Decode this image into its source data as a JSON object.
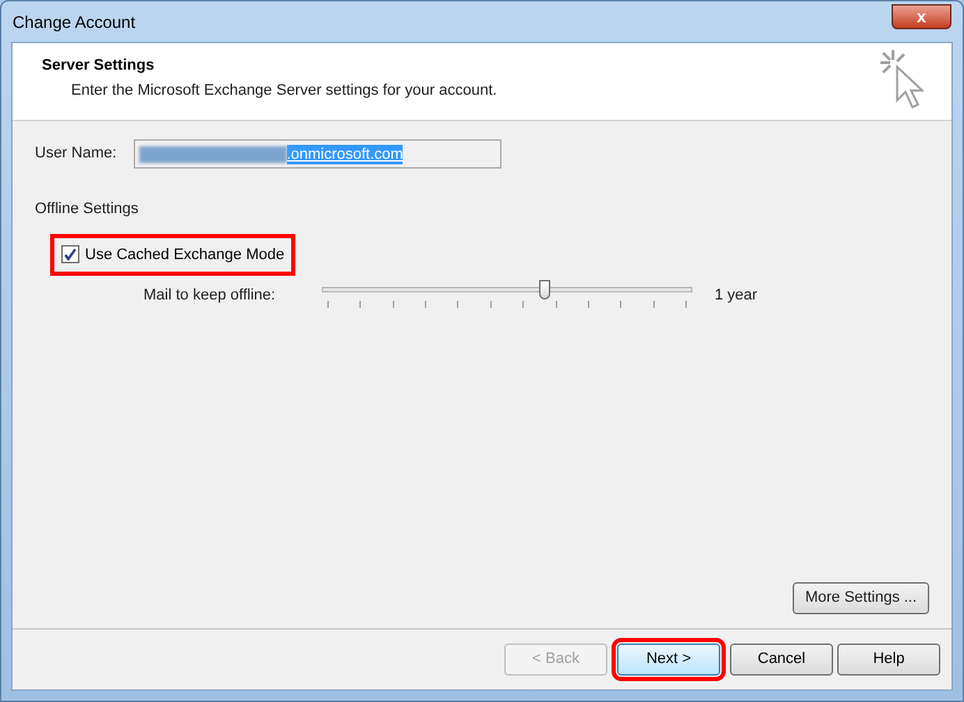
{
  "window": {
    "title": "Change Account",
    "close_label": "x"
  },
  "header": {
    "title": "Server Settings",
    "subtitle": "Enter the Microsoft Exchange Server settings for your account."
  },
  "user_name": {
    "label": "User Name:",
    "value": ".onmicrosoft.com",
    "redacted": true
  },
  "offline": {
    "heading": "Offline Settings",
    "cached_mode": {
      "label": "Use Cached Exchange Mode",
      "checked": true,
      "highlighted": true
    },
    "slider": {
      "label": "Mail to keep offline:",
      "level": 0.6,
      "reading": "1 year"
    }
  },
  "more_settings": "More Settings ...",
  "buttons": [
    {
      "label": "< Back",
      "disabled": true,
      "highlighted": false
    },
    {
      "label": "Next >",
      "disabled": false,
      "highlighted": true
    },
    {
      "label": "Cancel",
      "disabled": false,
      "highlighted": false
    },
    {
      "label": "Help",
      "disabled": false,
      "highlighted": false
    }
  ]
}
